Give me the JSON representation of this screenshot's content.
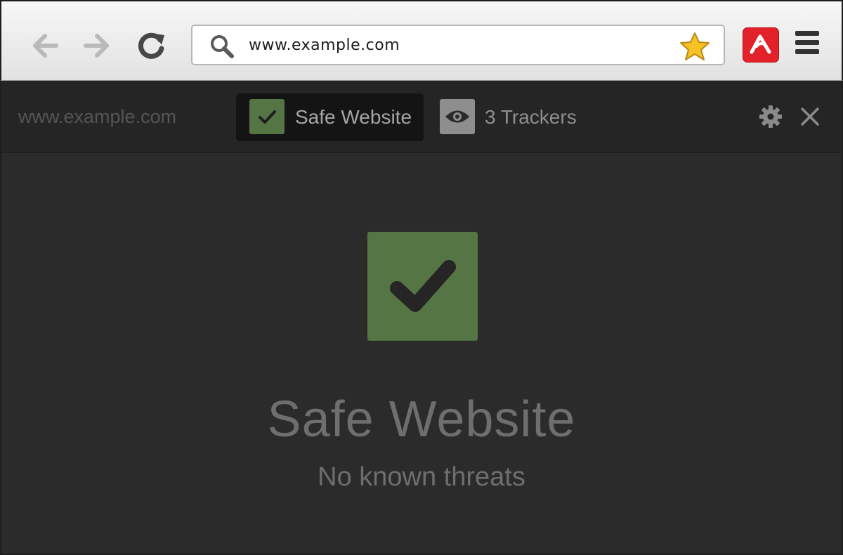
{
  "browser": {
    "address_bar": {
      "url": "www.example.com"
    },
    "icons": {
      "back": "arrow-left-icon",
      "forward": "arrow-right-icon",
      "reload": "reload-icon",
      "search": "search-icon",
      "bookmark": "star-icon",
      "extension": "umbrella-icon",
      "menu": "hamburger-menu-icon"
    },
    "colors": {
      "extension_badge": "#e3212b",
      "bookmark_star": "#f6c226"
    }
  },
  "extension": {
    "site": "www.example.com",
    "tabs": [
      {
        "label": "Safe Website",
        "icon": "check-icon",
        "active": true
      },
      {
        "label": "3 Trackers",
        "icon": "eye-icon",
        "active": false
      }
    ],
    "icons": {
      "settings": "gear-icon",
      "close": "close-icon"
    },
    "status": {
      "title": "Safe Website",
      "subtitle": "No known threats",
      "icon": "check-icon",
      "color": "#567544"
    }
  }
}
